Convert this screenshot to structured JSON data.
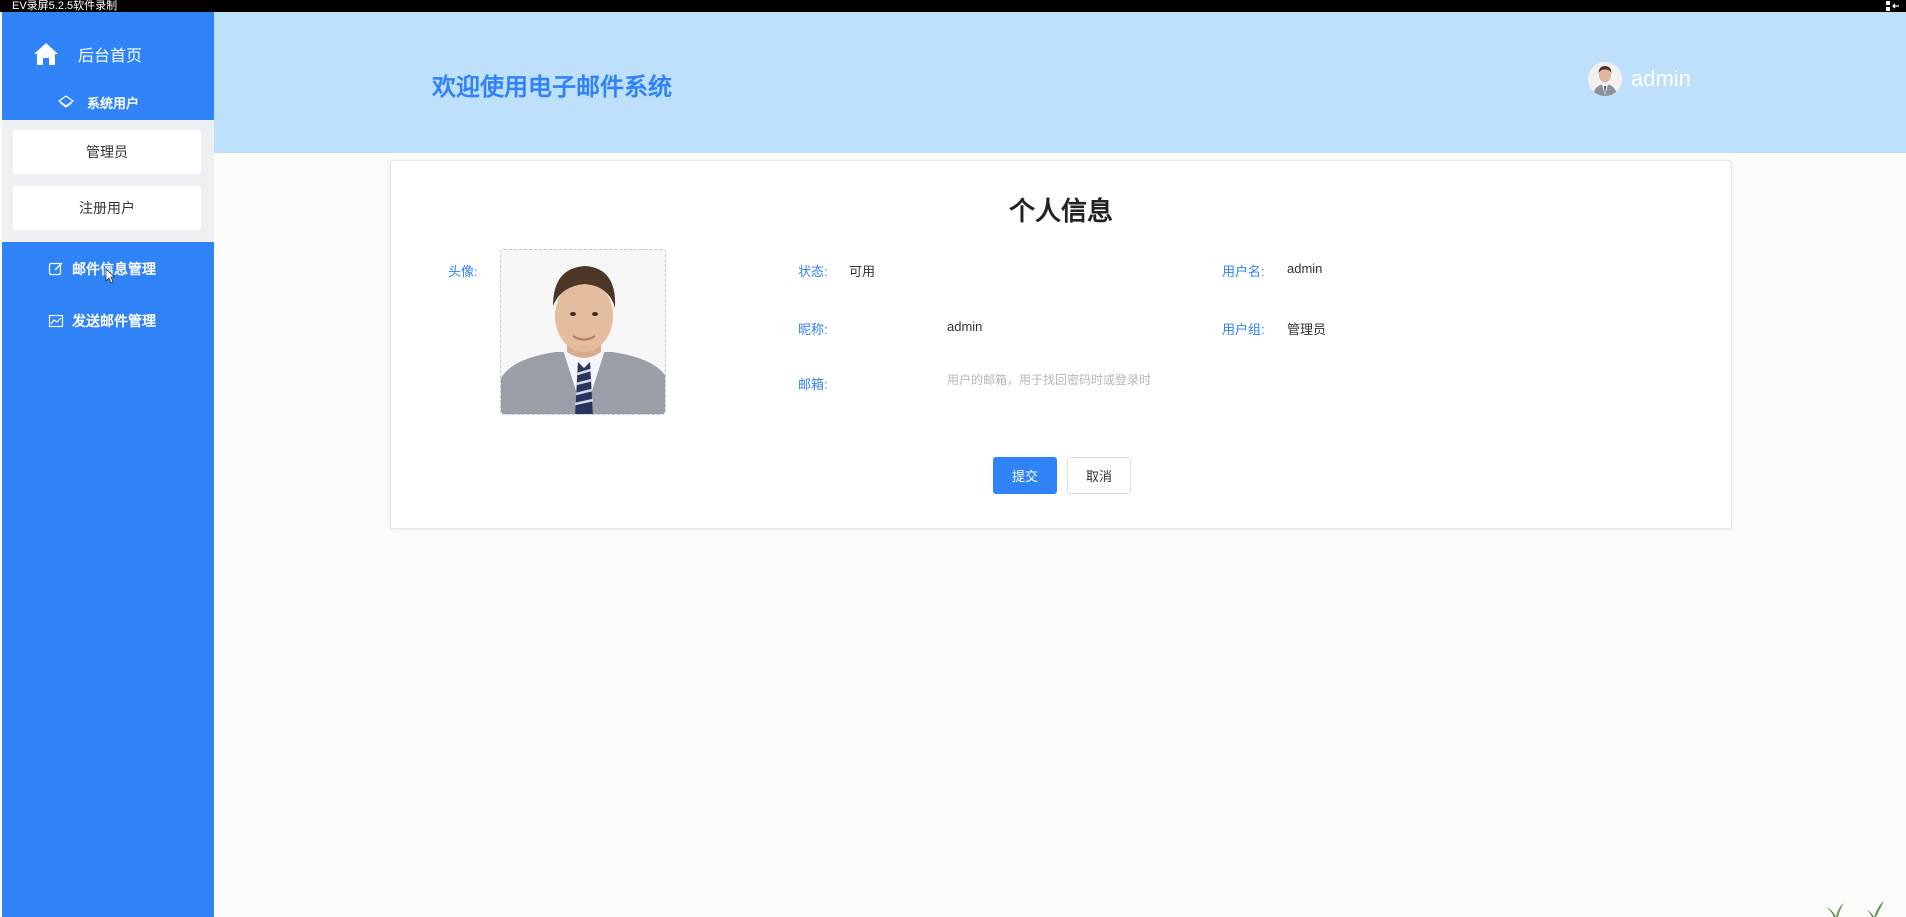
{
  "recorder": {
    "title": "EV录屏5.2.5软件录制"
  },
  "sidebar": {
    "home_label": "后台首页",
    "group_title": "系统用户",
    "submenu": [
      {
        "label": "管理员"
      },
      {
        "label": "注册用户"
      }
    ],
    "items": [
      {
        "label": "邮件信息管理"
      },
      {
        "label": "发送邮件管理"
      }
    ]
  },
  "header": {
    "title": "欢迎使用电子邮件系统",
    "username": "admin"
  },
  "profile": {
    "title": "个人信息",
    "avatar_label": "头像:",
    "status_label": "状态:",
    "status_value": "可用",
    "username_label": "用户名:",
    "username_value": "admin",
    "nickname_label": "昵称:",
    "nickname_value": "admin",
    "group_label": "用户组:",
    "group_value": "管理员",
    "email_label": "邮箱:",
    "email_value": "",
    "email_placeholder": "用户的邮箱，用于找回密码时或登录时",
    "submit_label": "提交",
    "cancel_label": "取消"
  },
  "colors": {
    "primary": "#2f83f7",
    "header_bg": "#bfe0fb",
    "submenu_bg": "#eef0f3"
  }
}
